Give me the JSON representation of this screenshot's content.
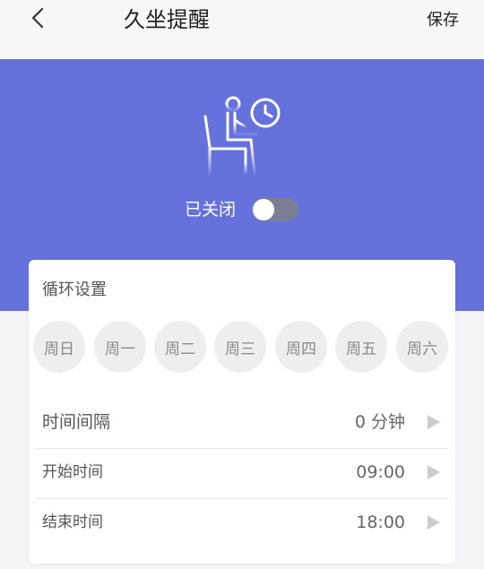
{
  "header": {
    "title": "久坐提醒",
    "save_label": "保存",
    "back_icon": "chevron-left-icon"
  },
  "hero": {
    "icon": "seated-person-clock-icon",
    "status_label": "已关闭",
    "toggle_on": false,
    "background_color": "#6572dc"
  },
  "repeat": {
    "title": "循环设置",
    "days": [
      "周日",
      "周一",
      "周二",
      "周三",
      "周四",
      "周五",
      "周六"
    ]
  },
  "settings": [
    {
      "label": "时间间隔",
      "value": "0 分钟"
    },
    {
      "label": "开始时间",
      "value": "09:00"
    },
    {
      "label": "结束时间",
      "value": "18:00"
    }
  ]
}
